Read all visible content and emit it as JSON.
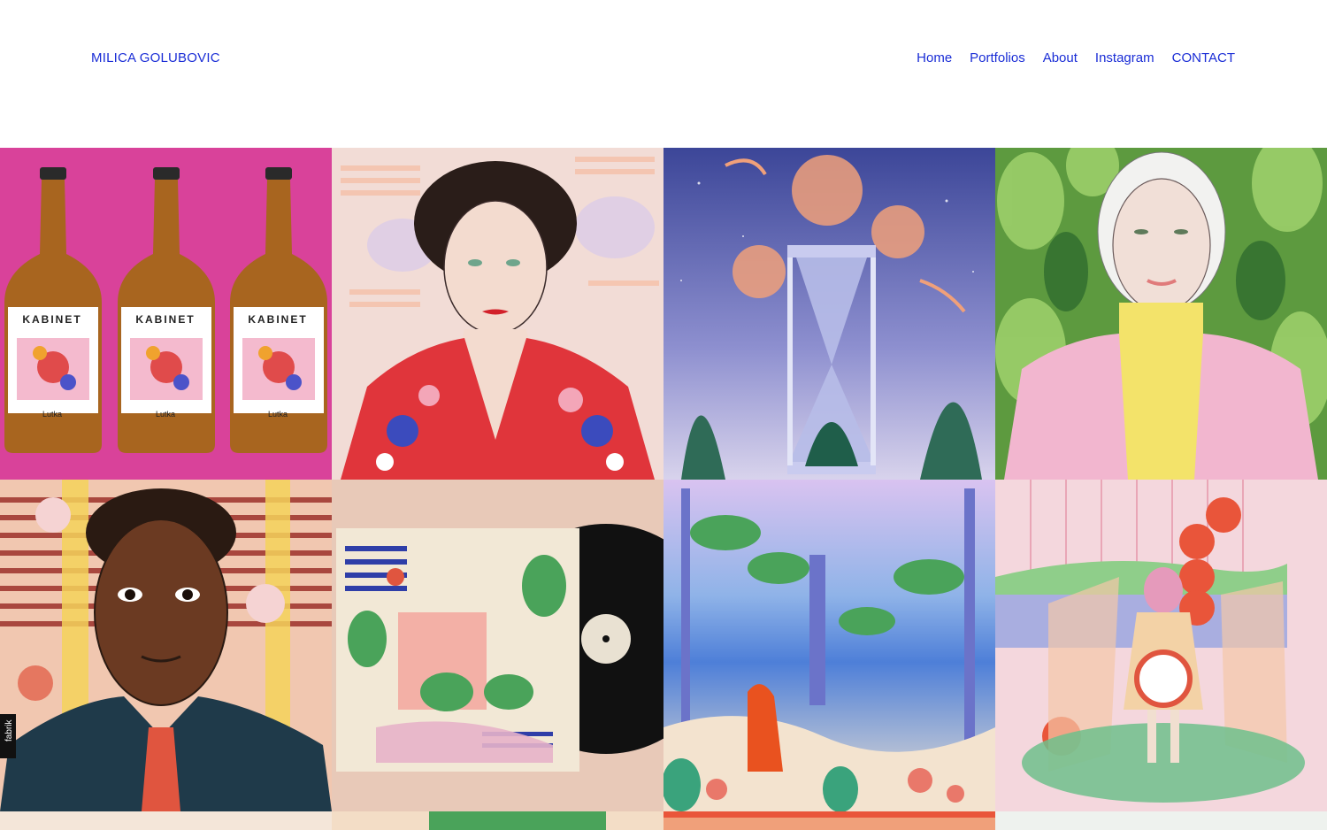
{
  "site": {
    "title": "MILICA GOLUBOVIC"
  },
  "nav": {
    "items": [
      {
        "label": "Home"
      },
      {
        "label": "Portfolios"
      },
      {
        "label": "About"
      },
      {
        "label": "Instagram"
      },
      {
        "label": "CONTACT"
      }
    ]
  },
  "portfolio": {
    "tiles": [
      {
        "name": "kabinet-beer-bottles",
        "bottle_brand": "KABINET",
        "bottle_label": "Lutka",
        "background": "#d9429a"
      },
      {
        "name": "portrait-woman-floral",
        "background": "#f2dcd6"
      },
      {
        "name": "hourglass-night-garden",
        "background": "#5b63b6"
      },
      {
        "name": "portrait-elderly-woman-leaves",
        "background": "#6fa847"
      },
      {
        "name": "portrait-man-tie",
        "badge": "fabrik",
        "background": "#f1c7b0"
      },
      {
        "name": "vinyl-record-cover",
        "background": "#e8c9b8"
      },
      {
        "name": "seaside-palms-scene",
        "background": "#8fb3e8"
      },
      {
        "name": "woman-window-sunsets",
        "background": "#f4d7dd"
      }
    ]
  }
}
